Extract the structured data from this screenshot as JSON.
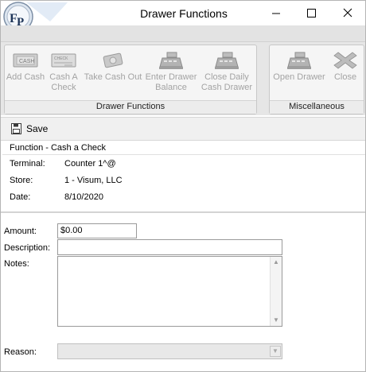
{
  "window": {
    "title": "Drawer Functions"
  },
  "window_controls": {
    "minimize": "─",
    "maximize": "☐",
    "close": "✕"
  },
  "ribbon": {
    "drawer_group": {
      "label": "Drawer Functions",
      "buttons": [
        {
          "line1": "Add Cash",
          "line2": ""
        },
        {
          "line1": "Cash A",
          "line2": "Check"
        },
        {
          "line1": "Take Cash Out",
          "line2": ""
        },
        {
          "line1": "Enter Drawer",
          "line2": "Balance"
        },
        {
          "line1": "Close Daily",
          "line2": "Cash Drawer"
        }
      ]
    },
    "misc_group": {
      "label": "Miscellaneous",
      "buttons": [
        {
          "line1": "Open Drawer"
        },
        {
          "line1": "Close"
        }
      ]
    }
  },
  "toolbar": {
    "save_label": "Save"
  },
  "info": {
    "header": "Function - Cash a Check",
    "terminal_label": "Terminal:",
    "terminal_value": "Counter 1^@",
    "store_label": "Store:",
    "store_value": "1 - Visum, LLC",
    "date_label": "Date:",
    "date_value": "8/10/2020"
  },
  "form": {
    "amount_label": "Amount:",
    "amount_value": "$0.00",
    "description_label": "Description:",
    "description_value": "",
    "notes_label": "Notes:",
    "notes_value": "",
    "reason_label": "Reason:",
    "reason_value": ""
  }
}
